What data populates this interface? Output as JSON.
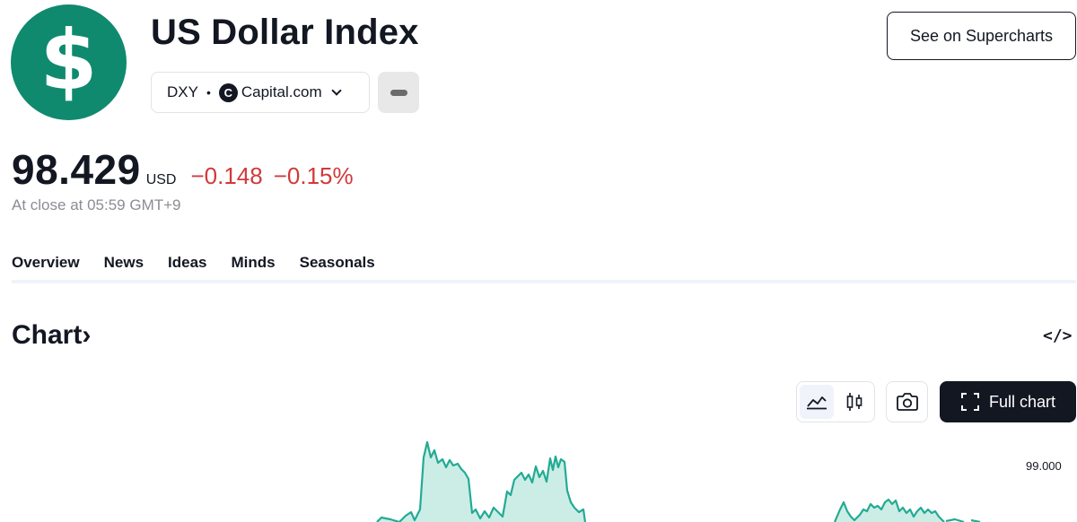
{
  "header": {
    "logo_glyph": "$",
    "title": "US Dollar Index",
    "symbol": "DXY",
    "separator": "•",
    "exchange_icon_glyph": "C",
    "exchange": "Capital.com",
    "supercharts_label": "See on Supercharts"
  },
  "quote": {
    "price": "98.429",
    "currency": "USD",
    "change": "−0.148",
    "change_percent": "−0.15%",
    "status": "At close at 05:59 GMT+9"
  },
  "tabs": [
    {
      "label": "Overview",
      "active": true
    },
    {
      "label": "News"
    },
    {
      "label": "Ideas"
    },
    {
      "label": "Minds"
    },
    {
      "label": "Seasonals"
    }
  ],
  "chart_section": {
    "heading": "Chart",
    "heading_arrow": "›",
    "embed_icon_glyph": "</>",
    "full_chart_label": "Full chart",
    "y_axis_label": "99.000",
    "line_color": "#22ab94",
    "fill_color": "#ccede6"
  },
  "colors": {
    "brand": "#0f8a6e",
    "negative": "#d03a3a",
    "text": "#131722",
    "muted": "#8a8d93"
  }
}
